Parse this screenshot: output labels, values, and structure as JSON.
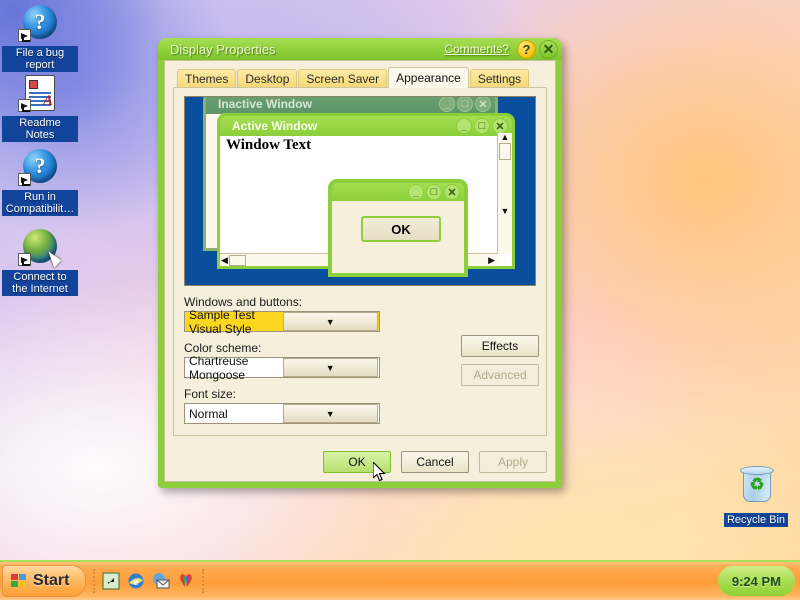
{
  "desktop": {
    "icons": [
      {
        "label": "File a bug report",
        "icon": "help-ball-icon",
        "shortcut": true
      },
      {
        "label": "Readme Notes",
        "icon": "notepad-document-icon",
        "shortcut": true
      },
      {
        "label": "Run in Compatibilit…",
        "icon": "help-ball-icon",
        "shortcut": true
      },
      {
        "label": "Connect to the Internet",
        "icon": "globe-cursor-icon",
        "shortcut": true
      },
      {
        "label": "Recycle Bin",
        "icon": "recycle-bin-icon",
        "shortcut": false
      }
    ]
  },
  "taskbar": {
    "start_label": "Start",
    "clock": "9:24 PM",
    "quick_launch": [
      {
        "name": "show-desktop-icon"
      },
      {
        "name": "internet-explorer-icon"
      },
      {
        "name": "outlook-express-icon"
      },
      {
        "name": "media-player-icon"
      }
    ]
  },
  "dialog": {
    "title": "Display Properties",
    "comments_link": "Comments?",
    "help_button": "?",
    "close_button": "✕",
    "tabs": [
      {
        "label": "Themes",
        "active": false
      },
      {
        "label": "Desktop",
        "active": false
      },
      {
        "label": "Screen Saver",
        "active": false
      },
      {
        "label": "Appearance",
        "active": true
      },
      {
        "label": "Settings",
        "active": false
      }
    ],
    "preview": {
      "inactive_window_title": "Inactive Window",
      "active_window_title": "Active Window",
      "window_text": "Window Text",
      "message_ok_label": "OK",
      "minimize_glyph": "_",
      "maximize_glyph": "□",
      "close_glyph": "✕",
      "scroll_up_glyph": "▲",
      "scroll_down_glyph": "▼",
      "scroll_left_glyph": "◀",
      "scroll_right_glyph": "▶"
    },
    "fields": {
      "windows_buttons_label": "Windows and buttons:",
      "windows_buttons_value": "Sample Test Visual Style",
      "color_scheme_label": "Color scheme:",
      "color_scheme_value": "Chartreuse Mongoose",
      "font_size_label": "Font size:",
      "font_size_value": "Normal",
      "dropdown_arrow": "▼"
    },
    "buttons": {
      "effects": "Effects",
      "advanced": "Advanced",
      "ok": "OK",
      "cancel": "Cancel",
      "apply": "Apply"
    }
  },
  "colors": {
    "accent_green": "#8ccf3a",
    "title_green": "#93d23f",
    "tab_yellow": "#f5d977",
    "selected_yellow": "#fcd61f",
    "dialog_face": "#f6efdc",
    "preview_blue": "#0a4f9e",
    "taskbar_orange": "#ff9f3c",
    "tray_green": "#a9dd53"
  }
}
